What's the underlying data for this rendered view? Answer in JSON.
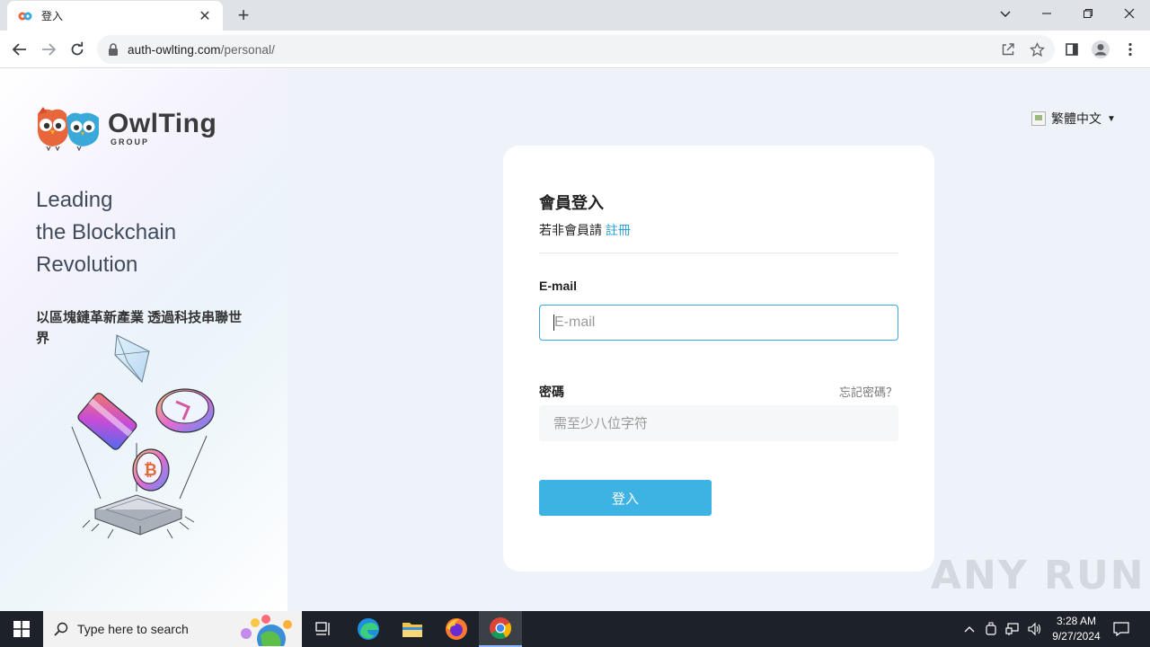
{
  "browser": {
    "tab_title": "登入",
    "tab_close": "✕",
    "new_tab": "+",
    "url_domain": "auth-owlting.com",
    "url_path": "/personal/"
  },
  "sidebar": {
    "logo_name": "OwlTing",
    "logo_sub": "GROUP",
    "tagline_lines": [
      "Leading",
      "the Blockchain",
      "Revolution"
    ],
    "subtagline": "以區塊鏈革新產業 透過科技串聯世界"
  },
  "language": {
    "selected": "繁體中文",
    "caret": "▼"
  },
  "login": {
    "title": "會員登入",
    "sub_prefix": "若非會員請",
    "register_link": "註冊",
    "email_label": "E-mail",
    "email_placeholder": "E-mail",
    "password_label": "密碼",
    "forgot_link": "忘記密碼？",
    "password_placeholder": "需至少八位字符",
    "submit_label": "登入"
  },
  "watermark": "ANY RUN",
  "taskbar": {
    "search_placeholder": "Type here to search",
    "time": "3:28 AM",
    "date": "9/27/2024"
  },
  "colors": {
    "accent": "#3db3e3",
    "link": "#2fa1d6",
    "taskbar": "#1d2129"
  }
}
